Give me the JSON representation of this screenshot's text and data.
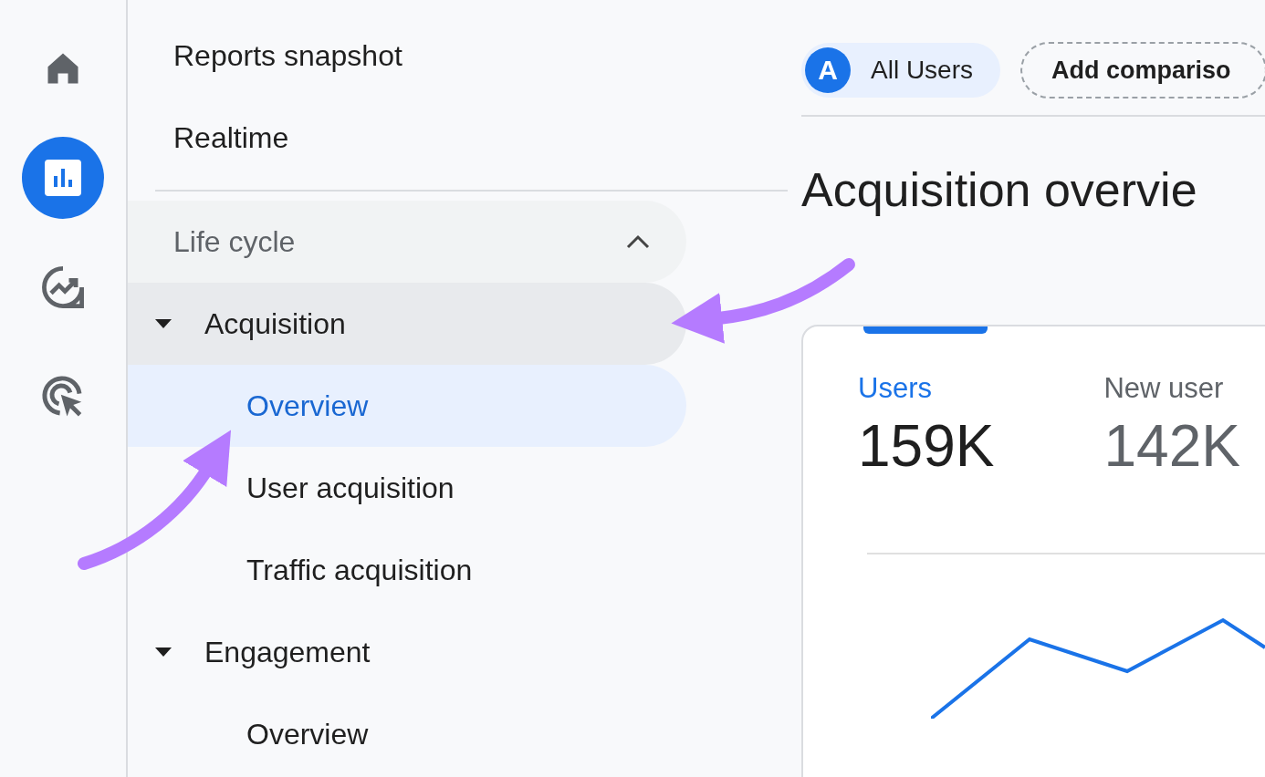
{
  "rail": [
    {
      "kind": "home",
      "selected": false
    },
    {
      "kind": "reports",
      "selected": true
    },
    {
      "kind": "explore",
      "selected": false
    },
    {
      "kind": "advertising",
      "selected": false
    }
  ],
  "nav": {
    "top_items": [
      {
        "label": "Reports snapshot"
      },
      {
        "label": "Realtime"
      }
    ],
    "section": {
      "label": "Life cycle",
      "expanded": true,
      "topics": [
        {
          "label": "Acquisition",
          "expanded": true,
          "active": true,
          "children": [
            {
              "label": "Overview",
              "selected": true
            },
            {
              "label": "User acquisition",
              "selected": false
            },
            {
              "label": "Traffic acquisition",
              "selected": false
            }
          ]
        },
        {
          "label": "Engagement",
          "expanded": true,
          "active": false,
          "children": [
            {
              "label": "Overview",
              "selected": false
            }
          ]
        }
      ]
    }
  },
  "comparison_bar": {
    "segment": {
      "badge": "A",
      "label": "All Users"
    },
    "add_button": "Add compariso"
  },
  "page_title": "Acquisition overvie",
  "card": {
    "metrics": [
      {
        "label": "Users",
        "value": "159K",
        "selected": true
      },
      {
        "label": "New user",
        "value": "142K",
        "selected": false
      }
    ]
  },
  "annotations": [
    {
      "kind": "arrow"
    },
    {
      "kind": "arrow"
    }
  ]
}
